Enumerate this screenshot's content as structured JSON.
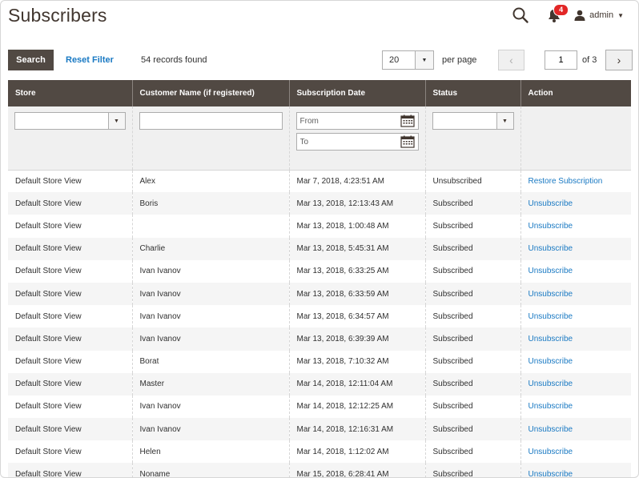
{
  "page": {
    "title": "Subscribers"
  },
  "header": {
    "notifications_count": "4",
    "user_name": "admin",
    "icons": [
      "search-icon",
      "bell-icon",
      "user-icon",
      "chevron-down-icon"
    ]
  },
  "toolbar": {
    "search_label": "Search",
    "reset_filter_label": "Reset Filter",
    "records_found": "54 records found",
    "per_page_value": "20",
    "per_page_label": "per page",
    "current_page": "1",
    "of_pages": "of 3"
  },
  "grid": {
    "columns": [
      "Store",
      "Customer Name (if registered)",
      "Subscription Date",
      "Status",
      "Action"
    ],
    "filters": {
      "date_from_placeholder": "From",
      "date_to_placeholder": "To"
    },
    "rows": [
      {
        "store": "Default Store View",
        "customer": "Alex",
        "date": "Mar 7, 2018, 4:23:51 AM",
        "status": "Unsubscribed",
        "action": "Restore Subscription"
      },
      {
        "store": "Default Store View",
        "customer": "Boris",
        "date": "Mar 13, 2018, 12:13:43 AM",
        "status": "Subscribed",
        "action": "Unsubscribe"
      },
      {
        "store": "Default Store View",
        "customer": "",
        "date": "Mar 13, 2018, 1:00:48 AM",
        "status": "Subscribed",
        "action": "Unsubscribe"
      },
      {
        "store": "Default Store View",
        "customer": "Charlie",
        "date": "Mar 13, 2018, 5:45:31 AM",
        "status": "Subscribed",
        "action": "Unsubscribe"
      },
      {
        "store": "Default Store View",
        "customer": "Ivan Ivanov",
        "date": "Mar 13, 2018, 6:33:25 AM",
        "status": "Subscribed",
        "action": "Unsubscribe"
      },
      {
        "store": "Default Store View",
        "customer": "Ivan Ivanov",
        "date": "Mar 13, 2018, 6:33:59 AM",
        "status": "Subscribed",
        "action": "Unsubscribe"
      },
      {
        "store": "Default Store View",
        "customer": "Ivan Ivanov",
        "date": "Mar 13, 2018, 6:34:57 AM",
        "status": "Subscribed",
        "action": "Unsubscribe"
      },
      {
        "store": "Default Store View",
        "customer": "Ivan Ivanov",
        "date": "Mar 13, 2018, 6:39:39 AM",
        "status": "Subscribed",
        "action": "Unsubscribe"
      },
      {
        "store": "Default Store View",
        "customer": "Borat",
        "date": "Mar 13, 2018, 7:10:32 AM",
        "status": "Subscribed",
        "action": "Unsubscribe"
      },
      {
        "store": "Default Store View",
        "customer": "Master",
        "date": "Mar 14, 2018, 12:11:04 AM",
        "status": "Subscribed",
        "action": "Unsubscribe"
      },
      {
        "store": "Default Store View",
        "customer": "Ivan Ivanov",
        "date": "Mar 14, 2018, 12:12:25 AM",
        "status": "Subscribed",
        "action": "Unsubscribe"
      },
      {
        "store": "Default Store View",
        "customer": "Ivan Ivanov",
        "date": "Mar 14, 2018, 12:16:31 AM",
        "status": "Subscribed",
        "action": "Unsubscribe"
      },
      {
        "store": "Default Store View",
        "customer": "Helen",
        "date": "Mar 14, 2018, 1:12:02 AM",
        "status": "Subscribed",
        "action": "Unsubscribe"
      },
      {
        "store": "Default Store View",
        "customer": "Noname",
        "date": "Mar 15, 2018, 6:28:41 AM",
        "status": "Subscribed",
        "action": "Unsubscribe"
      }
    ]
  },
  "colors": {
    "header_bg": "#514943",
    "link": "#1979c3",
    "badge": "#e22626"
  }
}
